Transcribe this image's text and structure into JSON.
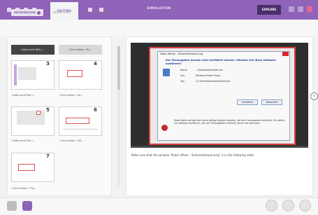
{
  "titlebar": {
    "tab_label": "EDITING",
    "title": "SIMULATION",
    "action_button": "EXPLORE"
  },
  "subtabs": {
    "items": [
      "INFORMATION",
      "MEDIA FILES",
      "TEXT PROCESSING"
    ]
  },
  "left_panel": {
    "top_buttons": [
      "Video and Roll-I...",
      "Click button \"Ac..."
    ],
    "thumbnails": [
      {
        "number": "3",
        "caption": "Video and Roll-I..."
      },
      {
        "number": "4",
        "caption": "Click button \"Ak..."
      },
      {
        "number": "5",
        "caption": "Video and Roll-I..."
      },
      {
        "number": "6",
        "caption": "Click button \"OK..."
      },
      {
        "number": "7",
        "caption": "Click button \"Ow..."
      }
    ]
  },
  "dialog": {
    "title": "Datei offnen - Sicherheitswarnung",
    "heading": "Der Herausgeber konnte nicht verifiziert werden. Möchten Sie diese Software ausführen?",
    "rows": [
      {
        "label": "Name:",
        "value": "...\\Downloads\\install.exe"
      },
      {
        "label": "Von:",
        "value": "Windows Media Player"
      },
      {
        "label": "Typ:",
        "value": "C:\\Users\\Downloads\\install.exe"
      }
    ],
    "buttons": [
      "Ausführen",
      "Abbrechen"
    ],
    "warning": "Diese Datei verfügt über keine gültige digitale Signatur, die den Herausgeber verifiziert. Sie sollten nur Software ausführen, die von Herausgebern stammt, denen Sie vertrauen."
  },
  "caption": "Make sure that the window \"Datei offnen - Sicherheitswarnung\" is in the following state.",
  "colors": {
    "accent": "#8e63b8",
    "highlight": "#d94040"
  }
}
